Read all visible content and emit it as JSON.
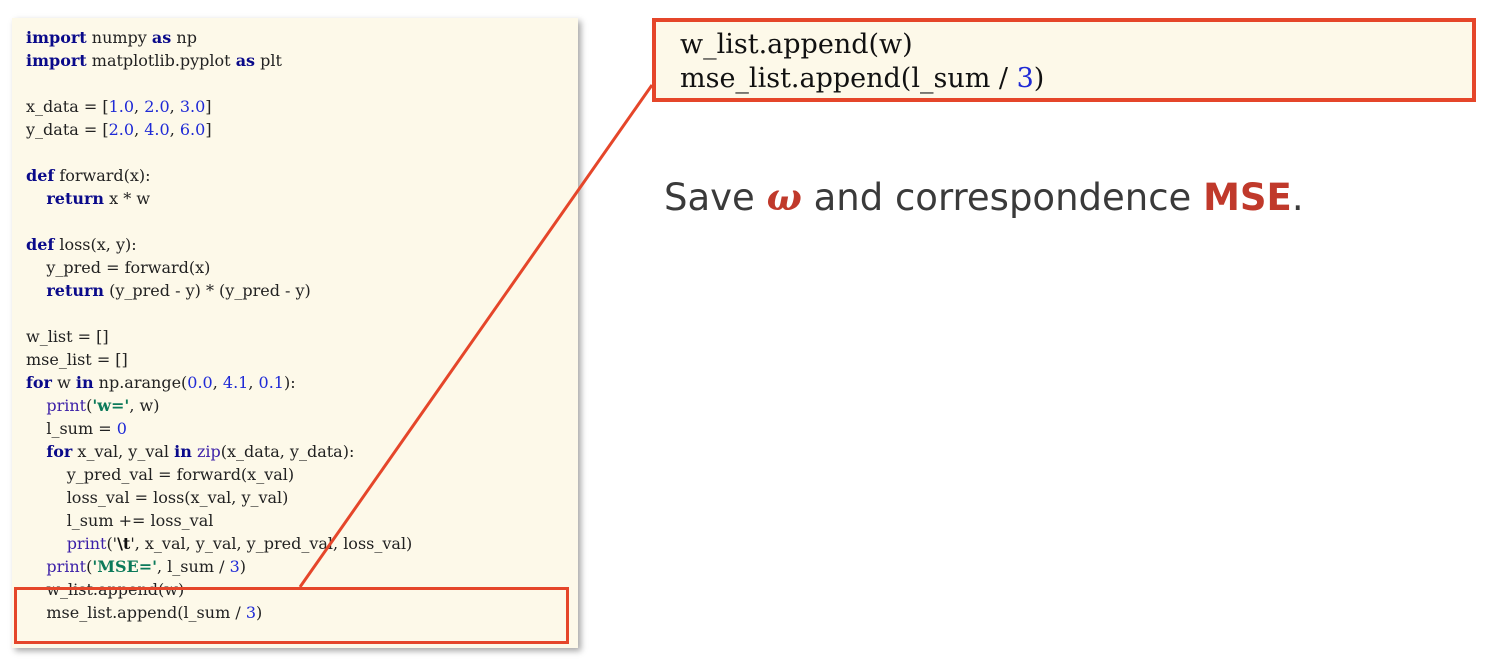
{
  "code_lines": [
    [
      {
        "t": "import",
        "c": "kw"
      },
      {
        "t": " numpy "
      },
      {
        "t": "as",
        "c": "kw"
      },
      {
        "t": " np"
      }
    ],
    [
      {
        "t": "import",
        "c": "kw"
      },
      {
        "t": " matplotlib.pyplot "
      },
      {
        "t": "as",
        "c": "kw"
      },
      {
        "t": " plt"
      }
    ],
    [],
    [
      {
        "t": "x_data = ["
      },
      {
        "t": "1.0",
        "c": "num"
      },
      {
        "t": ", "
      },
      {
        "t": "2.0",
        "c": "num"
      },
      {
        "t": ", "
      },
      {
        "t": "3.0",
        "c": "num"
      },
      {
        "t": "]"
      }
    ],
    [
      {
        "t": "y_data = ["
      },
      {
        "t": "2.0",
        "c": "num"
      },
      {
        "t": ", "
      },
      {
        "t": "4.0",
        "c": "num"
      },
      {
        "t": ", "
      },
      {
        "t": "6.0",
        "c": "num"
      },
      {
        "t": "]"
      }
    ],
    [],
    [
      {
        "t": "def",
        "c": "kw"
      },
      {
        "t": " forward(x):"
      }
    ],
    [
      {
        "t": "    "
      },
      {
        "t": "return",
        "c": "kw"
      },
      {
        "t": " x * w"
      }
    ],
    [],
    [
      {
        "t": "def",
        "c": "kw"
      },
      {
        "t": " loss(x, y):"
      }
    ],
    [
      {
        "t": "    y_pred = forward(x)"
      }
    ],
    [
      {
        "t": "    "
      },
      {
        "t": "return",
        "c": "kw"
      },
      {
        "t": " (y_pred - y) * (y_pred - y)"
      }
    ],
    [],
    [
      {
        "t": "w_list = []"
      }
    ],
    [
      {
        "t": "mse_list = []"
      }
    ],
    [
      {
        "t": "for",
        "c": "kw"
      },
      {
        "t": " w "
      },
      {
        "t": "in",
        "c": "kw"
      },
      {
        "t": " np.arange("
      },
      {
        "t": "0.0",
        "c": "num"
      },
      {
        "t": ", "
      },
      {
        "t": "4.1",
        "c": "num"
      },
      {
        "t": ", "
      },
      {
        "t": "0.1",
        "c": "num"
      },
      {
        "t": "):"
      }
    ],
    [
      {
        "t": "    "
      },
      {
        "t": "print",
        "c": "fn"
      },
      {
        "t": "("
      },
      {
        "t": "'w='",
        "c": "str"
      },
      {
        "t": ", w)"
      }
    ],
    [
      {
        "t": "    l_sum = "
      },
      {
        "t": "0",
        "c": "num"
      }
    ],
    [
      {
        "t": "    "
      },
      {
        "t": "for",
        "c": "kw"
      },
      {
        "t": " x_val, y_val "
      },
      {
        "t": "in",
        "c": "kw"
      },
      {
        "t": " "
      },
      {
        "t": "zip",
        "c": "fn"
      },
      {
        "t": "(x_data, y_data):"
      }
    ],
    [
      {
        "t": "        y_pred_val = forward(x_val)"
      }
    ],
    [
      {
        "t": "        loss_val = loss(x_val, y_val)"
      }
    ],
    [
      {
        "t": "        l_sum += loss_val"
      }
    ],
    [
      {
        "t": "        "
      },
      {
        "t": "print",
        "c": "fn"
      },
      {
        "t": "('"
      },
      {
        "t": "\\t",
        "c": "esc"
      },
      {
        "t": "', x_val, y_val, y_pred_val, loss_val)"
      }
    ],
    [
      {
        "t": "    "
      },
      {
        "t": "print",
        "c": "fn"
      },
      {
        "t": "("
      },
      {
        "t": "'MSE='",
        "c": "str"
      },
      {
        "t": ", l_sum / "
      },
      {
        "t": "3",
        "c": "num"
      },
      {
        "t": ")"
      }
    ],
    [
      {
        "t": "    w_list.append(w)"
      }
    ],
    [
      {
        "t": "    mse_list.append(l_sum / "
      },
      {
        "t": "3",
        "c": "num"
      },
      {
        "t": ")"
      }
    ]
  ],
  "zoom": {
    "line1": "w_list.append(w)",
    "line2_prefix": "mse_list.append(l_sum / ",
    "line2_num": "3",
    "line2_suffix": ")"
  },
  "caption": {
    "prefix": "Save ",
    "omega": "ω",
    "middle": " and correspondence ",
    "mse": "MSE",
    "suffix": "."
  },
  "colors": {
    "highlight": "#e5462a",
    "keyword": "#0a0a8a",
    "number": "#1f2ad6",
    "string": "#0c7a5a",
    "accent": "#c0392b",
    "panel_bg": "#fdf9e9"
  }
}
